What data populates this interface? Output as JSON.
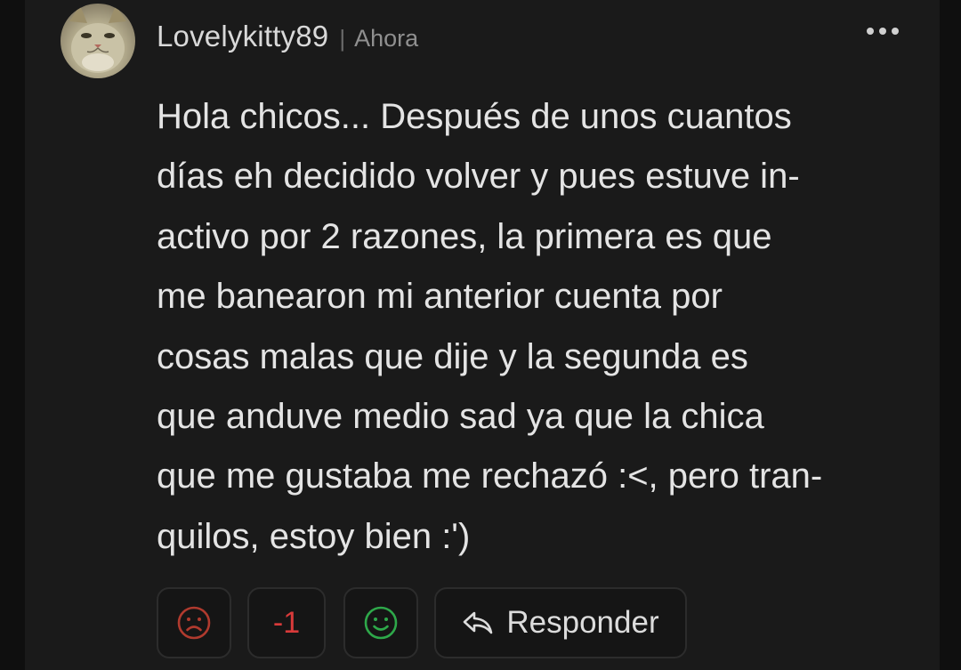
{
  "comment": {
    "username": "Lovelykitty89",
    "separator": "|",
    "timestamp": "Ahora",
    "text": "Hola chicos... Después de unos cuantos\ndías eh decidido volver y pues estuve in-\nactivo por 2 razones, la primera es que\nme banearon mi anterior cuenta por\ncosas malas que dije y la segunda es\nque anduve medio sad ya que la chica\nque me gustaba me rechazó :<, pero tran-\nquilos, estoy bien :')",
    "score": "-1"
  },
  "actions": {
    "reply_label": "Responder",
    "downvote_icon": "sad-face-icon",
    "upvote_icon": "happy-face-icon",
    "reply_icon": "reply-arrow-icon",
    "more_icon": "more-options-icon"
  },
  "colors": {
    "background": "#1a1a1a",
    "text": "#e4e4e4",
    "downvote": "#c0392b",
    "upvote": "#2ea84a",
    "score": "#d83a3a"
  }
}
